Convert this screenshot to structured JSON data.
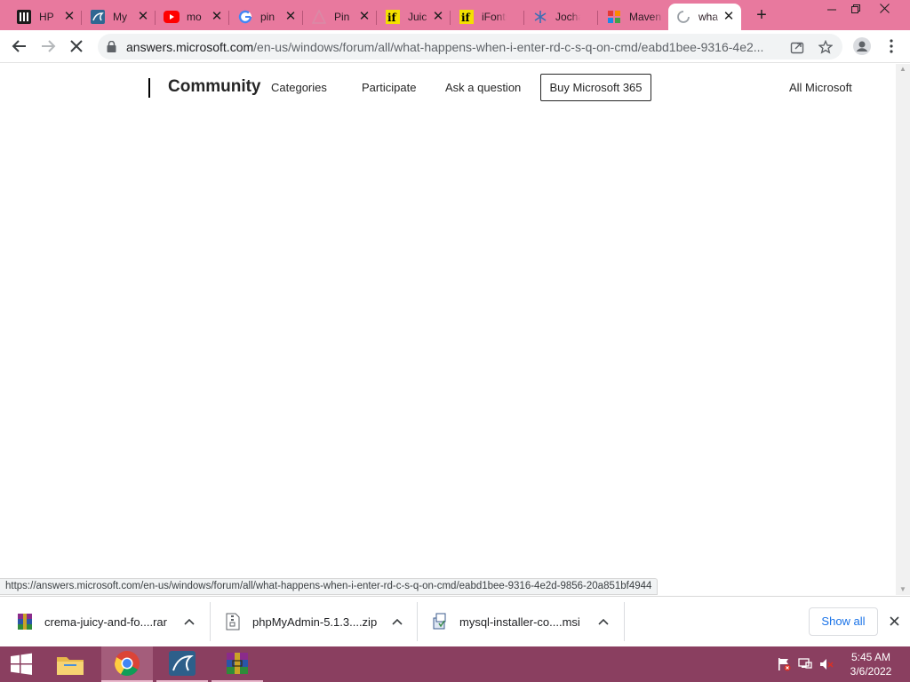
{
  "browser": {
    "tabs": [
      {
        "title": "HP",
        "icon": "hp-site-icon"
      },
      {
        "title": "My",
        "icon": "mysql-dolphin-icon"
      },
      {
        "title": "mo",
        "icon": "youtube-icon"
      },
      {
        "title": "pin",
        "icon": "google-icon"
      },
      {
        "title": "Pin",
        "icon": "triangle-logo-icon"
      },
      {
        "title": "Juic",
        "icon": "ifonts-icon"
      },
      {
        "title": "iFonts -",
        "icon": "ifonts-icon"
      },
      {
        "title": "Jochan",
        "icon": "snowflake-icon"
      },
      {
        "title": "Maven",
        "icon": "colorful-blocks-icon"
      },
      {
        "title": "wha",
        "icon": "loading-spinner-icon",
        "active": true
      }
    ],
    "new_tab_label": "+",
    "url_host": "answers.microsoft.com",
    "url_path": "/en-us/windows/forum/all/what-happens-when-i-enter-rd-c-s-q-on-cmd/eabd1bee-9316-4e2..."
  },
  "page": {
    "brand": "Community",
    "nav": [
      "Categories",
      "Participate",
      "Ask a question"
    ],
    "buy_button": "Buy Microsoft 365",
    "all_microsoft": "All Microsoft"
  },
  "status_url": "https://answers.microsoft.com/en-us/windows/forum/all/what-happens-when-i-enter-rd-c-s-q-on-cmd/eabd1bee-9316-4e2d-9856-20a851bf4944",
  "downloads": {
    "items": [
      {
        "name": "crema-juicy-and-fo....rar",
        "icon": "winrar-archive-icon"
      },
      {
        "name": "phpMyAdmin-5.1.3....zip",
        "icon": "zip-file-icon"
      },
      {
        "name": "mysql-installer-co....msi",
        "icon": "installer-package-icon"
      }
    ],
    "show_all": "Show all"
  },
  "taskbar": {
    "time": "5:45 AM",
    "date": "3/6/2022"
  },
  "colors": {
    "tabstrip": "#e8799e",
    "taskbar": "#8a3f60",
    "link_blue": "#1a73e8"
  }
}
